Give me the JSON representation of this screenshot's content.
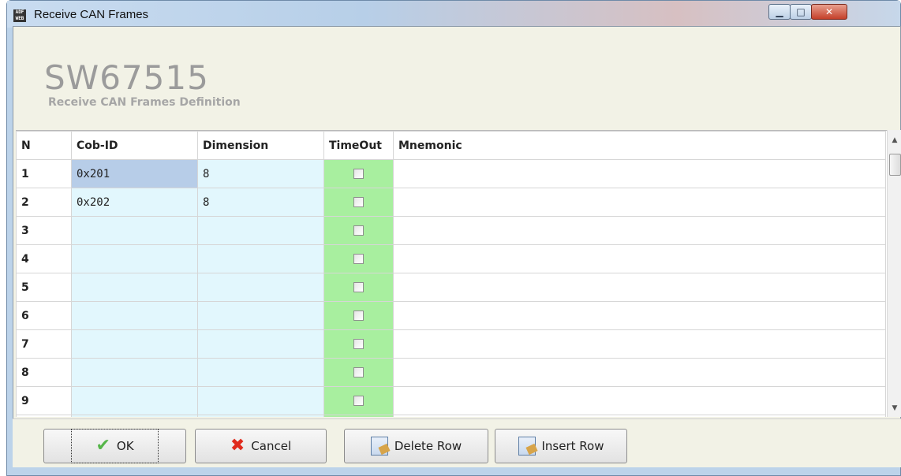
{
  "window": {
    "title": "Receive CAN Frames"
  },
  "header": {
    "brand": "SW67515",
    "subtitle": "Receive CAN Frames Definition"
  },
  "table": {
    "columns": [
      "N",
      "Cob-ID",
      "Dimension",
      "TimeOut",
      "Mnemonic"
    ],
    "rows": [
      {
        "n": "1",
        "cob": "0x201",
        "dim": "8",
        "timeout": false,
        "mnemonic": ""
      },
      {
        "n": "2",
        "cob": "0x202",
        "dim": "8",
        "timeout": false,
        "mnemonic": ""
      },
      {
        "n": "3",
        "cob": "",
        "dim": "",
        "timeout": false,
        "mnemonic": ""
      },
      {
        "n": "4",
        "cob": "",
        "dim": "",
        "timeout": false,
        "mnemonic": ""
      },
      {
        "n": "5",
        "cob": "",
        "dim": "",
        "timeout": false,
        "mnemonic": ""
      },
      {
        "n": "6",
        "cob": "",
        "dim": "",
        "timeout": false,
        "mnemonic": ""
      },
      {
        "n": "7",
        "cob": "",
        "dim": "",
        "timeout": false,
        "mnemonic": ""
      },
      {
        "n": "8",
        "cob": "",
        "dim": "",
        "timeout": false,
        "mnemonic": ""
      },
      {
        "n": "9",
        "cob": "",
        "dim": "",
        "timeout": false,
        "mnemonic": ""
      }
    ]
  },
  "buttons": {
    "ok": "OK",
    "cancel": "Cancel",
    "delete_row": "Delete Row",
    "insert_row": "Insert Row"
  },
  "icons": {
    "app": "adfweb-icon",
    "ok": "checkmark-icon",
    "cancel": "red-x-icon",
    "delete_row": "delete-row-icon",
    "insert_row": "insert-row-icon"
  },
  "colors": {
    "key_column_bg": "#e2f7fd",
    "selected_cell_bg": "#b7cde8",
    "timeout_column_bg": "#a8ef9f"
  }
}
